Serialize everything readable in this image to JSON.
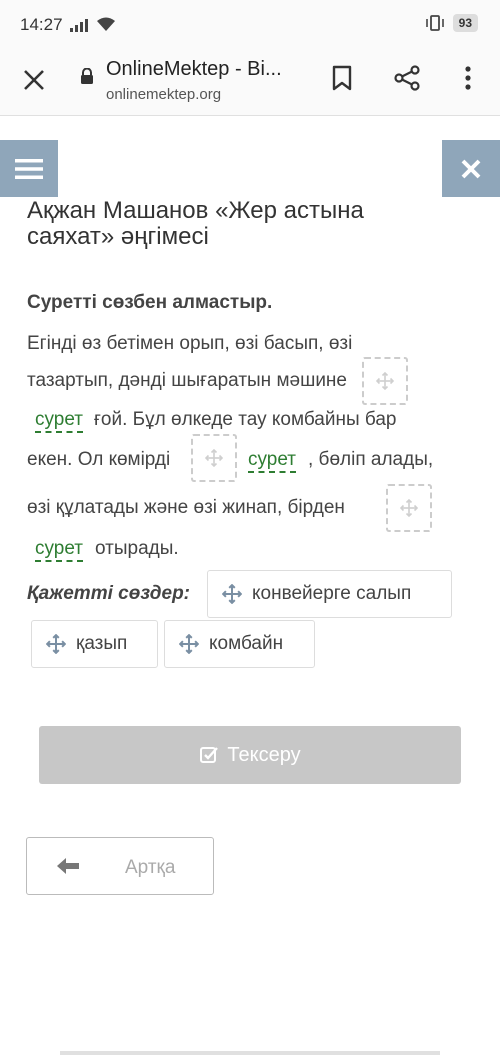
{
  "status_bar": {
    "time": "14:27",
    "battery": "93",
    "icons": [
      "signal-icon",
      "wifi-icon",
      "vibrate-icon",
      "battery-icon"
    ]
  },
  "browser": {
    "page_title": "OnlineMektep - Bi...",
    "url": "onlinemektep.org",
    "icons": [
      "close-icon",
      "lock-icon",
      "bookmark-icon",
      "share-icon",
      "more-icon"
    ]
  },
  "header": {
    "menu_icon": "hamburger-icon",
    "close_icon": "close-icon"
  },
  "lesson": {
    "title": "Ақжан Машанов «Жер астына саяхат» әңгімесі",
    "instruction": "Суретті сөзбен алмастыр.",
    "lines": {
      "l1": "Егінді өз бетімен орып, өзі басып, өзі",
      "l2": "тазартып, дәнді шығаратын мәшине",
      "l3_rest": "ғой. Бұл өлкеде тау комбайны бар",
      "l4a": "екен. Ол көмірді",
      "l4b": ", бөліп алады,",
      "l5": "өзі құлатады және өзі жинап, бірден",
      "l6_rest": "отырады."
    },
    "blank_word": "сурет",
    "needed_label": "Қажетті сөздер:",
    "chips": [
      "конвейерге салып",
      "қазып",
      "комбайн"
    ]
  },
  "actions": {
    "check_label": "Тексеру",
    "back_label": "Артқа"
  },
  "colors": {
    "accent": "#8fa6ba",
    "blank_green": "#2e7d32",
    "disabled_button": "#c7c7c7"
  }
}
